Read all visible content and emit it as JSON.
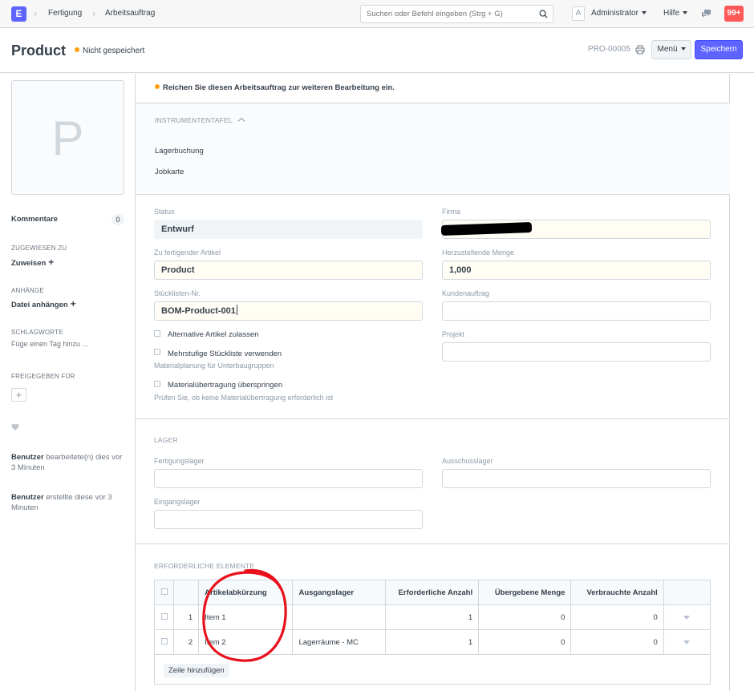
{
  "navbar": {
    "logo_letter": "E",
    "breadcrumbs": [
      "Fertigung",
      "Arbeitsauftrag"
    ],
    "search_placeholder": "Suchen oder Befehl eingeben (Strg + G)",
    "avatar_letter": "A",
    "user": "Administrator",
    "help": "Hilfe",
    "notifications": "99+"
  },
  "page_head": {
    "title": "Product",
    "indicator": "Nicht gespeichert",
    "doc_name": "PRO-00005",
    "menu_label": "Menü",
    "save_label": "Speichern"
  },
  "sidebar": {
    "image_letter": "P",
    "comments_label": "Kommentare",
    "comments_count": "0",
    "assigned_head": "ZUGEWIESEN ZU",
    "assign_label": "Zuweisen",
    "attachments_head": "ANHÄNGE",
    "attach_label": "Datei anhängen",
    "tags_head": "SCHLAGWORTE",
    "tags_placeholder": "Füge einen Tag hinzu ...",
    "shared_head": "FREIGEGEBEN FÜR",
    "activity": [
      {
        "user": "Benutzer",
        "text": "bearbeitete(n) dies vor 3 Minuten"
      },
      {
        "user": "Benutzer",
        "text": "erstellte diese vor 3 Minuten"
      }
    ]
  },
  "form": {
    "message": "Reichen Sie diesen Arbeitsauftrag zur weiteren Bearbeitung ein.",
    "dashboard": {
      "title": "INSTRUMENTENTAFEL",
      "links": [
        "Lagerbuchung",
        "Jobkarte"
      ]
    },
    "fields": {
      "status_label": "Status",
      "status_value": "Entwurf",
      "company_label": "Firma",
      "item_label": "Zu fertigender Artikel",
      "item_value": "Product",
      "qty_label": "Herzustellende Menge",
      "qty_value": "1,000",
      "bom_label": "Stücklisten-Nr.",
      "bom_value": "BOM-Product-001",
      "sales_order_label": "Kundenauftrag",
      "project_label": "Projekt",
      "alt_item_label": "Alternative Artikel zulassen",
      "multi_bom_label": "Mehrstufige Stückliste verwenden",
      "multi_bom_desc": "Materialplanung für Unterbaugruppen",
      "skip_transfer_label": "Materialübertragung überspringen",
      "skip_transfer_desc": "Prüfen Sie, ob keine Materialübertragung erforderlich ist"
    },
    "warehouse": {
      "title": "LAGER",
      "wip_label": "Fertigungslager",
      "scrap_label": "Ausschusslager",
      "source_label": "Eingangslager"
    },
    "required_items": {
      "title": "ERFORDERLICHE ELEMENTE",
      "columns": [
        "Artikelabkürzung",
        "Ausgangslager",
        "Erforderliche Anzahl",
        "Übergebene Menge",
        "Verbrauchte Anzahl"
      ],
      "rows": [
        {
          "idx": "1",
          "item": "Item 1",
          "warehouse": "",
          "required": "1",
          "transferred": "0",
          "consumed": "0"
        },
        {
          "idx": "2",
          "item": "Item 2",
          "warehouse": "Lagerräume - MC",
          "required": "1",
          "transferred": "0",
          "consumed": "0"
        }
      ],
      "add_row": "Zeile hinzufügen"
    }
  },
  "colors": {
    "primary": "#5e64ff",
    "indicator_orange": "#ffa00a",
    "notif_red": "#ff5858",
    "annotation_red": "#e8101b"
  }
}
